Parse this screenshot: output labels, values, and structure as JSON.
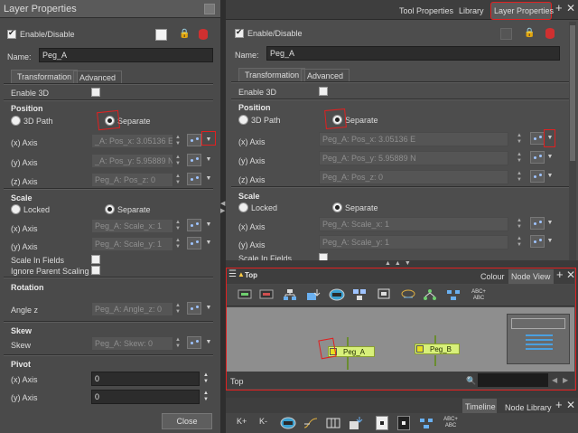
{
  "left_panel": {
    "title": "Layer Properties",
    "enable_label": "Enable/Disable",
    "name_label": "Name:",
    "name_value": "Peg_A",
    "tabs": [
      "Transformation",
      "Advanced"
    ],
    "enable3d_label": "Enable 3D",
    "position_header": "Position",
    "path3d_label": "3D Path",
    "separate_label": "Separate",
    "x_axis_label": "(x) Axis",
    "y_axis_label": "(y) Axis",
    "z_axis_label": "(z) Axis",
    "pos_x_value": "_A: Pos_x: 3.05136 E",
    "pos_y_value": "_A: Pos_y: 5.95889 N",
    "pos_z_value": "Peg_A: Pos_z: 0",
    "scale_header": "Scale",
    "locked_label": "Locked",
    "scale_x_value": "Peg_A: Scale_x: 1",
    "scale_y_value": "Peg_A: Scale_y: 1",
    "scale_in_fields_label": "Scale In Fields",
    "ignore_parent_label": "Ignore Parent Scaling",
    "rotation_header": "Rotation",
    "angle_z_label": "Angle z",
    "angle_z_value": "Peg_A: Angle_z: 0",
    "skew_header": "Skew",
    "skew_label": "Skew",
    "skew_value": "Peg_A: Skew: 0",
    "pivot_header": "Pivot",
    "pivot_x_value": "0",
    "pivot_y_value": "0",
    "close_label": "Close"
  },
  "right_panel": {
    "top_tabs": [
      "Tool Properties",
      "Library",
      "Layer Properties"
    ],
    "enable_label": "Enable/Disable",
    "name_label": "Name:",
    "name_value": "Peg_A",
    "tabs": [
      "Transformation",
      "Advanced"
    ],
    "enable3d_label": "Enable 3D",
    "position_header": "Position",
    "path3d_label": "3D Path",
    "separate_label": "Separate",
    "x_axis_label": "(x) Axis",
    "y_axis_label": "(y) Axis",
    "z_axis_label": "(z) Axis",
    "pos_x_value": "Peg_A: Pos_x: 3.05136 E",
    "pos_y_value": "Peg_A: Pos_y: 5.95889 N",
    "pos_z_value": "Peg_A: Pos_z: 0",
    "scale_header": "Scale",
    "locked_label": "Locked",
    "scale_x_value": "Peg_A: Scale_x: 1",
    "scale_y_value": "Peg_A: Scale_y: 1",
    "scale_in_fields_label": "Scale In Fields"
  },
  "node_view": {
    "title": "Top",
    "tabs": [
      "Colour",
      "Node View"
    ],
    "node_a": "Peg_A",
    "node_b": "Peg_B",
    "breadcrumb": "Top",
    "abc_icon_label": "ABC+ABC"
  },
  "bottom": {
    "tabs": [
      "Timeline",
      "Node Library"
    ],
    "k_plus": "K+",
    "k_minus": "K-",
    "abc_label": "ABC+ABC"
  }
}
